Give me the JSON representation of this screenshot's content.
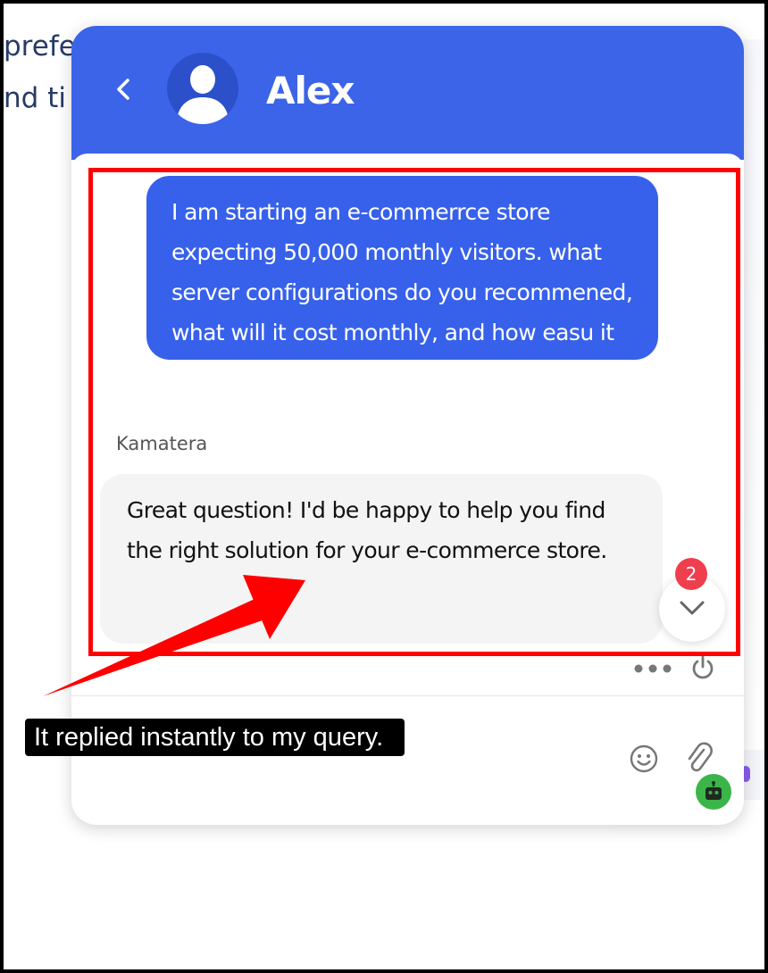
{
  "background": {
    "line1": "prefer",
    "line2": "nd ti"
  },
  "chat": {
    "agent_name": "Alex",
    "messages": [
      {
        "role": "user",
        "text": "I am starting an e-commerrce store expecting 50,000 monthly visitors. what server configurations do you recommened, what will it cost monthly, and how easu it is to scale up when traffic increases ?"
      },
      {
        "role": "agent",
        "sender": "Kamatera",
        "text": "Great question! I'd be happy to help you find the right solution for your e-commerce store."
      }
    ],
    "unread_count": "2"
  },
  "annotation": {
    "caption": "It replied instantly to my query."
  },
  "colors": {
    "header": "#3c64e8",
    "user_bubble": "#3761ea",
    "agent_bubble": "#f4f4f5",
    "badge": "#ef3e4e",
    "highlight": "#ff0000",
    "bot": "#3bb54a"
  },
  "icons": {
    "back": "chevron-left-icon",
    "avatar": "user-avatar-icon",
    "scroll": "chevron-down-icon",
    "more": "more-horizontal-icon",
    "power": "power-icon",
    "emoji": "smiley-icon",
    "attach": "paperclip-icon",
    "bot": "robot-icon"
  }
}
